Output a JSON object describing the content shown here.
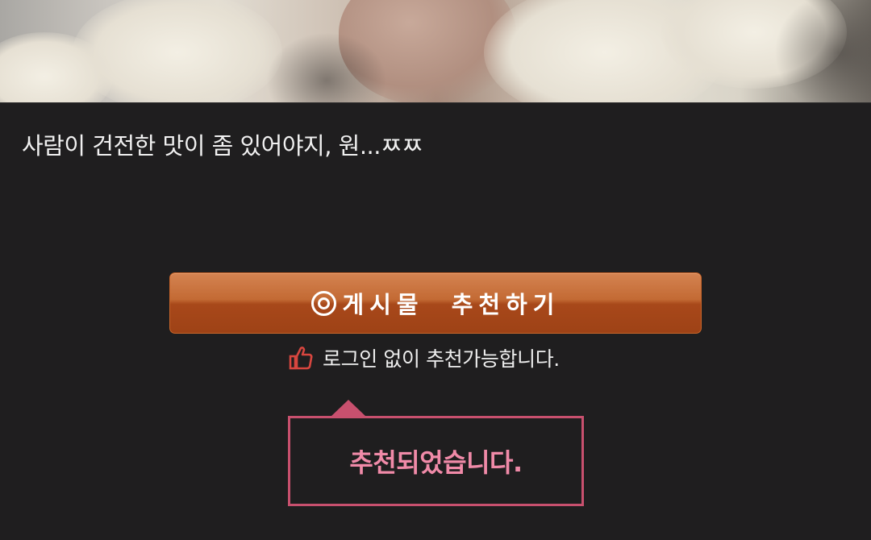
{
  "post": {
    "image_alt": "post photo",
    "text": "사람이 건전한 맛이 좀 있어야지, 원...ㅉㅉ"
  },
  "recommend": {
    "button_label": "게시물  추천하기",
    "icon": "target-circle-icon",
    "hint_icon": "thumbs-up-icon",
    "hint_text": "로그인 없이 추천가능합니다."
  },
  "notice": {
    "message": "추천되었습니다."
  },
  "colors": {
    "background": "#1f1e1f",
    "button": "#b4572a",
    "notice_border": "#c8506e",
    "notice_text": "#f08aa8"
  }
}
